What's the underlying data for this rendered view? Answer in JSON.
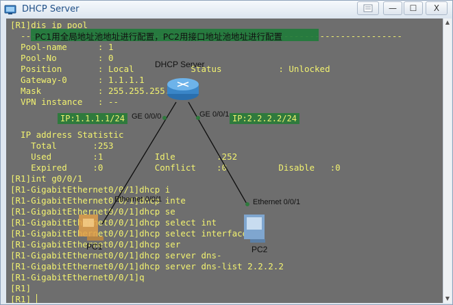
{
  "window": {
    "title": "DHCP Server",
    "controls": {
      "minimize": "—",
      "maximize": "☐",
      "close": "X"
    }
  },
  "note": "PC1用全局地址池地址进行配置，PC2用接口地址池地址进行配置",
  "console_lines": [
    "[R1]dis ip pool",
    "  --------------------------------------------------------------------------",
    "  Pool-name      : 1",
    "  Pool-No        : 0",
    "  Position       : Local           Status           : Unlocked",
    "  Gateway-0      : 1.1.1.1",
    "  Mask           : 255.255.255.0",
    "  VPN instance   : --",
    "",
    "",
    "  IP address Statistic",
    "    Total       :253",
    "    Used        :1          Idle        :252",
    "    Expired     :0          Conflict    :0          Disable   :0",
    "[R1]int g0/0/1",
    "[R1-GigabitEthernet0/0/1]dhcp i",
    "[R1-GigabitEthernet0/0/1]dhcp inte",
    "[R1-GigabitEthernet0/0/1]dhcp se",
    "[R1-GigabitEthernet0/0/1]dhcp select int",
    "[R1-GigabitEthernet0/0/1]dhcp select interface",
    "[R1-GigabitEthernet0/0/1]dhcp ser",
    "[R1-GigabitEthernet0/0/1]dhcp server dns-",
    "[R1-GigabitEthernet0/0/1]dhcp server dns-list 2.2.2.2",
    "[R1-GigabitEthernet0/0/1]q",
    "[R1]",
    "[R1]"
  ],
  "topology": {
    "router_label": "DHCP Server",
    "port_left": "GE 0/0/0",
    "port_right": "GE 0/0/1",
    "ip_left": "IP:1.1.1.1/24",
    "ip_right": "IP:2.2.2.2/24",
    "pc1_label": "PC1",
    "pc2_label": "PC2",
    "pc1_port": "Ethernet 0/0/1",
    "pc2_port": "Ethernet 0/0/1"
  },
  "colors": {
    "console_bg": "#6e6e6e",
    "console_text": "#f2f270",
    "ip_box": "#2f7a3d",
    "router": "#3a86c8"
  }
}
